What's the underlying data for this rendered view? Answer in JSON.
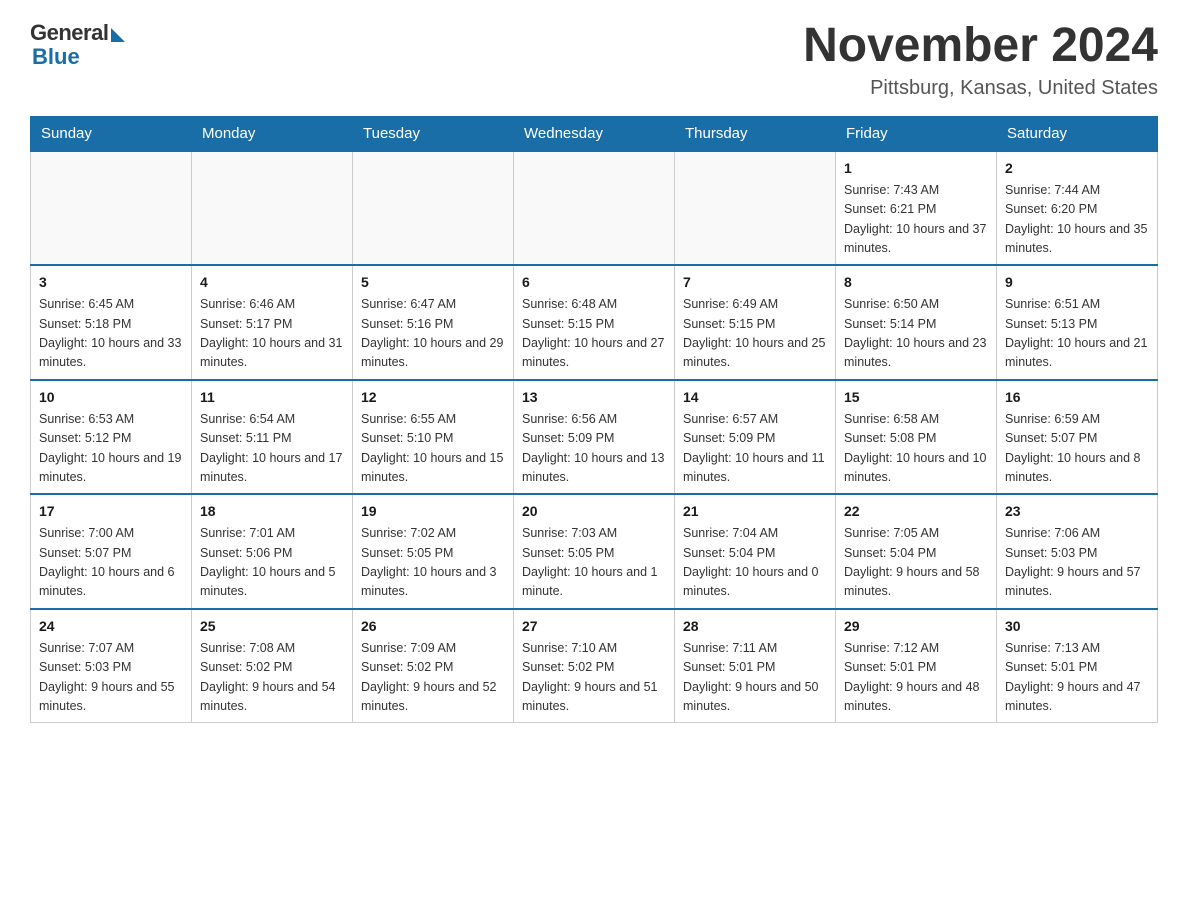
{
  "header": {
    "logo_general": "General",
    "logo_blue": "Blue",
    "month_title": "November 2024",
    "location": "Pittsburg, Kansas, United States"
  },
  "calendar": {
    "days_of_week": [
      "Sunday",
      "Monday",
      "Tuesday",
      "Wednesday",
      "Thursday",
      "Friday",
      "Saturday"
    ],
    "weeks": [
      [
        {
          "day": "",
          "info": ""
        },
        {
          "day": "",
          "info": ""
        },
        {
          "day": "",
          "info": ""
        },
        {
          "day": "",
          "info": ""
        },
        {
          "day": "",
          "info": ""
        },
        {
          "day": "1",
          "info": "Sunrise: 7:43 AM\nSunset: 6:21 PM\nDaylight: 10 hours and 37 minutes."
        },
        {
          "day": "2",
          "info": "Sunrise: 7:44 AM\nSunset: 6:20 PM\nDaylight: 10 hours and 35 minutes."
        }
      ],
      [
        {
          "day": "3",
          "info": "Sunrise: 6:45 AM\nSunset: 5:18 PM\nDaylight: 10 hours and 33 minutes."
        },
        {
          "day": "4",
          "info": "Sunrise: 6:46 AM\nSunset: 5:17 PM\nDaylight: 10 hours and 31 minutes."
        },
        {
          "day": "5",
          "info": "Sunrise: 6:47 AM\nSunset: 5:16 PM\nDaylight: 10 hours and 29 minutes."
        },
        {
          "day": "6",
          "info": "Sunrise: 6:48 AM\nSunset: 5:15 PM\nDaylight: 10 hours and 27 minutes."
        },
        {
          "day": "7",
          "info": "Sunrise: 6:49 AM\nSunset: 5:15 PM\nDaylight: 10 hours and 25 minutes."
        },
        {
          "day": "8",
          "info": "Sunrise: 6:50 AM\nSunset: 5:14 PM\nDaylight: 10 hours and 23 minutes."
        },
        {
          "day": "9",
          "info": "Sunrise: 6:51 AM\nSunset: 5:13 PM\nDaylight: 10 hours and 21 minutes."
        }
      ],
      [
        {
          "day": "10",
          "info": "Sunrise: 6:53 AM\nSunset: 5:12 PM\nDaylight: 10 hours and 19 minutes."
        },
        {
          "day": "11",
          "info": "Sunrise: 6:54 AM\nSunset: 5:11 PM\nDaylight: 10 hours and 17 minutes."
        },
        {
          "day": "12",
          "info": "Sunrise: 6:55 AM\nSunset: 5:10 PM\nDaylight: 10 hours and 15 minutes."
        },
        {
          "day": "13",
          "info": "Sunrise: 6:56 AM\nSunset: 5:09 PM\nDaylight: 10 hours and 13 minutes."
        },
        {
          "day": "14",
          "info": "Sunrise: 6:57 AM\nSunset: 5:09 PM\nDaylight: 10 hours and 11 minutes."
        },
        {
          "day": "15",
          "info": "Sunrise: 6:58 AM\nSunset: 5:08 PM\nDaylight: 10 hours and 10 minutes."
        },
        {
          "day": "16",
          "info": "Sunrise: 6:59 AM\nSunset: 5:07 PM\nDaylight: 10 hours and 8 minutes."
        }
      ],
      [
        {
          "day": "17",
          "info": "Sunrise: 7:00 AM\nSunset: 5:07 PM\nDaylight: 10 hours and 6 minutes."
        },
        {
          "day": "18",
          "info": "Sunrise: 7:01 AM\nSunset: 5:06 PM\nDaylight: 10 hours and 5 minutes."
        },
        {
          "day": "19",
          "info": "Sunrise: 7:02 AM\nSunset: 5:05 PM\nDaylight: 10 hours and 3 minutes."
        },
        {
          "day": "20",
          "info": "Sunrise: 7:03 AM\nSunset: 5:05 PM\nDaylight: 10 hours and 1 minute."
        },
        {
          "day": "21",
          "info": "Sunrise: 7:04 AM\nSunset: 5:04 PM\nDaylight: 10 hours and 0 minutes."
        },
        {
          "day": "22",
          "info": "Sunrise: 7:05 AM\nSunset: 5:04 PM\nDaylight: 9 hours and 58 minutes."
        },
        {
          "day": "23",
          "info": "Sunrise: 7:06 AM\nSunset: 5:03 PM\nDaylight: 9 hours and 57 minutes."
        }
      ],
      [
        {
          "day": "24",
          "info": "Sunrise: 7:07 AM\nSunset: 5:03 PM\nDaylight: 9 hours and 55 minutes."
        },
        {
          "day": "25",
          "info": "Sunrise: 7:08 AM\nSunset: 5:02 PM\nDaylight: 9 hours and 54 minutes."
        },
        {
          "day": "26",
          "info": "Sunrise: 7:09 AM\nSunset: 5:02 PM\nDaylight: 9 hours and 52 minutes."
        },
        {
          "day": "27",
          "info": "Sunrise: 7:10 AM\nSunset: 5:02 PM\nDaylight: 9 hours and 51 minutes."
        },
        {
          "day": "28",
          "info": "Sunrise: 7:11 AM\nSunset: 5:01 PM\nDaylight: 9 hours and 50 minutes."
        },
        {
          "day": "29",
          "info": "Sunrise: 7:12 AM\nSunset: 5:01 PM\nDaylight: 9 hours and 48 minutes."
        },
        {
          "day": "30",
          "info": "Sunrise: 7:13 AM\nSunset: 5:01 PM\nDaylight: 9 hours and 47 minutes."
        }
      ]
    ]
  }
}
